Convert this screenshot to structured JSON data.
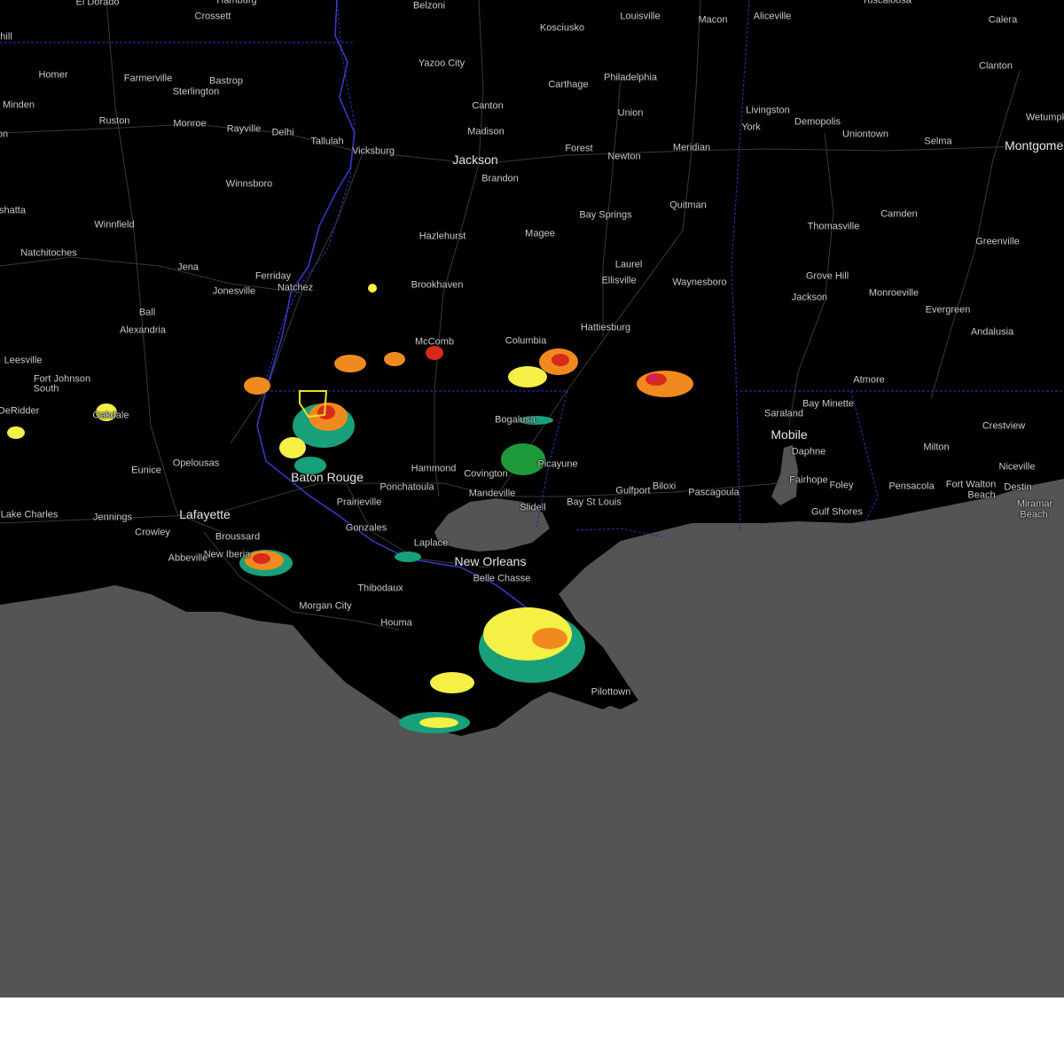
{
  "map": {
    "colors": {
      "land": "#000000",
      "water": "#545454",
      "roads": "#3a3a3a",
      "state_borders": "#2a2a9a",
      "warning_polygon": "#f0e020",
      "radar_light": "#18a07a",
      "radar_green": "#1e9a3a",
      "radar_yellow": "#f4f046",
      "radar_orange": "#f08a1e",
      "radar_red": "#d82a1a",
      "radar_magenta": "#d01a8a"
    },
    "cities": [
      {
        "name": "El Dorado",
        "size": "small"
      },
      {
        "name": "Crossett",
        "size": "small"
      },
      {
        "name": "Belzoni",
        "size": "small"
      },
      {
        "name": "Louisville",
        "size": "small"
      },
      {
        "name": "Macon",
        "size": "small"
      },
      {
        "name": "Aliceville",
        "size": "small"
      },
      {
        "name": "Tuscaloosa",
        "size": "small"
      },
      {
        "name": "Calera",
        "size": "small"
      },
      {
        "name": "Kosciusko",
        "size": "small"
      },
      {
        "name": "Yazoo City",
        "size": "small"
      },
      {
        "name": "Clanton",
        "size": "small"
      },
      {
        "name": "Homer",
        "size": "small"
      },
      {
        "name": "Farmerville",
        "size": "small"
      },
      {
        "name": "Bastrop",
        "size": "small"
      },
      {
        "name": "Sterlington",
        "size": "small"
      },
      {
        "name": "Carthage",
        "size": "small"
      },
      {
        "name": "Philadelphia",
        "size": "small"
      },
      {
        "name": "Minden",
        "size": "small"
      },
      {
        "name": "Canton",
        "size": "small"
      },
      {
        "name": "Union",
        "size": "small"
      },
      {
        "name": "Livingston",
        "size": "small"
      },
      {
        "name": "Wetumpka",
        "size": "small"
      },
      {
        "name": "Ruston",
        "size": "small"
      },
      {
        "name": "Monroe",
        "size": "small"
      },
      {
        "name": "Rayville",
        "size": "small"
      },
      {
        "name": "Delhi",
        "size": "small"
      },
      {
        "name": "Madison",
        "size": "small"
      },
      {
        "name": "York",
        "size": "small"
      },
      {
        "name": "Demopolis",
        "size": "small"
      },
      {
        "name": "Tallulah",
        "size": "small"
      },
      {
        "name": "Uniontown",
        "size": "small"
      },
      {
        "name": "Selma",
        "size": "small"
      },
      {
        "name": "Montgomery",
        "size": "big"
      },
      {
        "name": "Forest",
        "size": "small"
      },
      {
        "name": "Meridian",
        "size": "small"
      },
      {
        "name": "Vicksburg",
        "size": "small"
      },
      {
        "name": "Jackson",
        "size": "big"
      },
      {
        "name": "Newton",
        "size": "small"
      },
      {
        "name": "Brandon",
        "size": "small"
      },
      {
        "name": "Winnsboro",
        "size": "small"
      },
      {
        "name": "Quitman",
        "size": "small"
      },
      {
        "name": "Natchitoches",
        "size": "small"
      },
      {
        "name": "Winnfield",
        "size": "small"
      },
      {
        "name": "Bay Springs",
        "size": "small"
      },
      {
        "name": "Camden",
        "size": "small"
      },
      {
        "name": "Thomasville",
        "size": "small"
      },
      {
        "name": "Greenville",
        "size": "small"
      },
      {
        "name": "Hazlehurst",
        "size": "small"
      },
      {
        "name": "Magee",
        "size": "small"
      },
      {
        "name": "Laurel",
        "size": "small"
      },
      {
        "name": "Jena",
        "size": "small"
      },
      {
        "name": "Ferriday",
        "size": "small"
      },
      {
        "name": "Grove Hill",
        "size": "small"
      },
      {
        "name": "Ellisville",
        "size": "small"
      },
      {
        "name": "Waynesboro",
        "size": "small"
      },
      {
        "name": "Brookhaven",
        "size": "small"
      },
      {
        "name": "Jonesville",
        "size": "small"
      },
      {
        "name": "Natchez",
        "size": "small"
      },
      {
        "name": "Monroeville",
        "size": "small"
      },
      {
        "name": "Jackson",
        "size": "small"
      },
      {
        "name": "Evergreen",
        "size": "small"
      },
      {
        "name": "Ball",
        "size": "small"
      },
      {
        "name": "Alexandria",
        "size": "small"
      },
      {
        "name": "Hattiesburg",
        "size": "small"
      },
      {
        "name": "Andalusia",
        "size": "small"
      },
      {
        "name": "McComb",
        "size": "small"
      },
      {
        "name": "Columbia",
        "size": "small"
      },
      {
        "name": "Leesville",
        "size": "small"
      },
      {
        "name": "Fort Johnson",
        "size": "small"
      },
      {
        "name": "South",
        "size": "small"
      },
      {
        "name": "Atmore",
        "size": "small"
      },
      {
        "name": "Bay Minette",
        "size": "small"
      },
      {
        "name": "DeRidder",
        "size": "small"
      },
      {
        "name": "Oakdale",
        "size": "small"
      },
      {
        "name": "Saraland",
        "size": "small"
      },
      {
        "name": "Bogalusa",
        "size": "small"
      },
      {
        "name": "Crestview",
        "size": "small"
      },
      {
        "name": "Mobile",
        "size": "big"
      },
      {
        "name": "Milton",
        "size": "small"
      },
      {
        "name": "Daphne",
        "size": "small"
      },
      {
        "name": "Hammond",
        "size": "small"
      },
      {
        "name": "Picayune",
        "size": "small"
      },
      {
        "name": "Eunice",
        "size": "small"
      },
      {
        "name": "Opelousas",
        "size": "small"
      },
      {
        "name": "Niceville",
        "size": "small"
      },
      {
        "name": "Baton Rouge",
        "size": "big"
      },
      {
        "name": "Covington",
        "size": "small"
      },
      {
        "name": "Fairhope",
        "size": "small"
      },
      {
        "name": "Foley",
        "size": "small"
      },
      {
        "name": "Ponchatoula",
        "size": "small"
      },
      {
        "name": "Pensacola",
        "size": "small"
      },
      {
        "name": "Fort Walton",
        "size": "small"
      },
      {
        "name": "Beach",
        "size": "small"
      },
      {
        "name": "Destin",
        "size": "small"
      },
      {
        "name": "Mandeville",
        "size": "small"
      },
      {
        "name": "Biloxi",
        "size": "small"
      },
      {
        "name": "Gulfport",
        "size": "small"
      },
      {
        "name": "Pascagoula",
        "size": "small"
      },
      {
        "name": "Prairieville",
        "size": "small"
      },
      {
        "name": "Slidell",
        "size": "small"
      },
      {
        "name": "Bay St Louis",
        "size": "small"
      },
      {
        "name": "Miramar",
        "size": "small"
      },
      {
        "name": "Beach",
        "size": "small"
      },
      {
        "name": "Gulf Shores",
        "size": "small"
      },
      {
        "name": "Lake Charles",
        "size": "small"
      },
      {
        "name": "Jennings",
        "size": "small"
      },
      {
        "name": "Lafayette",
        "size": "big"
      },
      {
        "name": "Crowley",
        "size": "small"
      },
      {
        "name": "Gonzales",
        "size": "small"
      },
      {
        "name": "Broussard",
        "size": "small"
      },
      {
        "name": "Laplace",
        "size": "small"
      },
      {
        "name": "New Iberia",
        "size": "small"
      },
      {
        "name": "Abbeville",
        "size": "small"
      },
      {
        "name": "New Orleans",
        "size": "big"
      },
      {
        "name": "Belle Chasse",
        "size": "small"
      },
      {
        "name": "Thibodaux",
        "size": "small"
      },
      {
        "name": "Morgan City",
        "size": "small"
      },
      {
        "name": "Houma",
        "size": "small"
      },
      {
        "name": "Pilottown",
        "size": "small"
      },
      {
        "name": "hill",
        "size": "small"
      },
      {
        "name": "Hamburg",
        "size": "small"
      },
      {
        "name": "shatta",
        "size": "small"
      },
      {
        "name": "on",
        "size": "small"
      }
    ]
  }
}
